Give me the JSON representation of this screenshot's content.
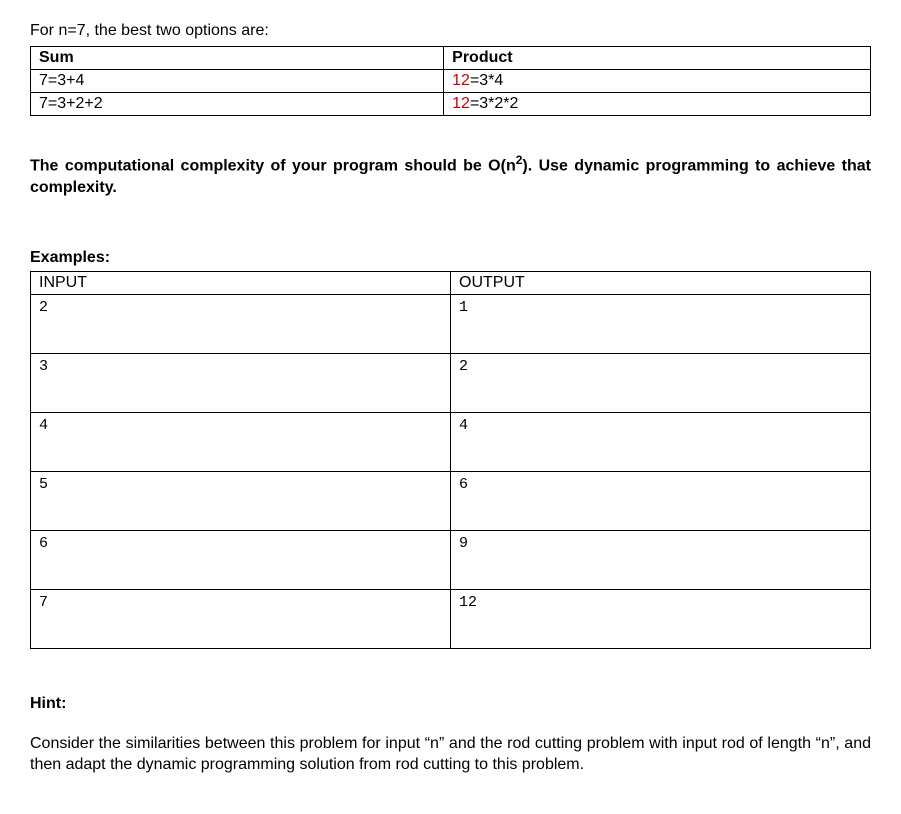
{
  "intro": "For n=7, the best two options are:",
  "options_table": {
    "headers": {
      "sum": "Sum",
      "product": "Product"
    },
    "rows": [
      {
        "sum": "7=3+4",
        "product_red": "12",
        "product_rest": "=3*4"
      },
      {
        "sum": "7=3+2+2",
        "product_red": "12",
        "product_rest": "=3*2*2"
      }
    ]
  },
  "complexity": {
    "pre": "The computational complexity of your program should be O(n",
    "sup": "2",
    "post": "). Use dynamic programming to achieve that complexity."
  },
  "examples": {
    "title": "Examples:",
    "headers": {
      "input": "INPUT",
      "output": "OUTPUT"
    },
    "rows": [
      {
        "input": "2",
        "output": "1"
      },
      {
        "input": "3",
        "output": "2"
      },
      {
        "input": "4",
        "output": "4"
      },
      {
        "input": "5",
        "output": "6"
      },
      {
        "input": "6",
        "output": "9"
      },
      {
        "input": "7",
        "output": "12"
      }
    ]
  },
  "hint": {
    "title": "Hint:",
    "body": "Consider the similarities between this problem for input “n” and the rod cutting problem with input rod of length “n”, and then adapt the dynamic programming solution from rod cutting to this problem."
  }
}
